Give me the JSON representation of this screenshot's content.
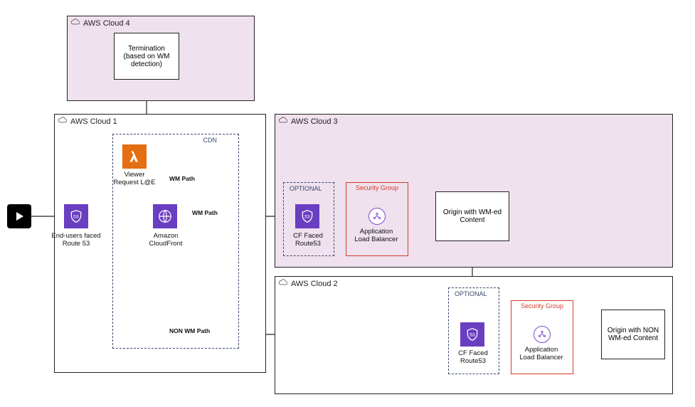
{
  "regions": {
    "cloud4": {
      "label": "AWS Cloud  4"
    },
    "cloud1": {
      "label": "AWS Cloud  1"
    },
    "cloud3": {
      "label": "AWS Cloud  3"
    },
    "cloud2": {
      "label": "AWS Cloud 2"
    }
  },
  "groups": {
    "cdn": {
      "label": "CDN"
    },
    "optional3": {
      "label": "OPTIONAL"
    },
    "optional2": {
      "label": "OPTIONAL"
    },
    "secgrp3": {
      "label": "Security Group"
    },
    "secgrp2": {
      "label": "Security Group"
    }
  },
  "nodes": {
    "termination": {
      "text": "Termination (based on WM detection)"
    },
    "endusers_r53": {
      "caption": "End-users faced Route 53"
    },
    "viewer_le": {
      "caption": "Viewer Request L@E"
    },
    "cloudfront": {
      "caption": "Amazon CloudFront"
    },
    "cf_r53_3": {
      "caption": "CF Faced Route53"
    },
    "alb3": {
      "caption": "Application Load Balancer"
    },
    "origin_wm": {
      "text": "Origin with WM-ed Content"
    },
    "cf_r53_2": {
      "caption": "CF Faced Route53"
    },
    "alb2": {
      "caption": "Application Load Balancer"
    },
    "origin_nonwm": {
      "text": "Origin with NON WM-ed Content"
    }
  },
  "edges": {
    "wm_path_vert": "WM Path",
    "wm_path_horz": "WM Path",
    "non_wm_path": "NON WM Path"
  },
  "icons": {
    "play": "play-icon",
    "route53": "route53-icon",
    "lambda": "lambda-icon",
    "cloudfront": "cloudfront-icon",
    "alb": "alb-icon"
  }
}
